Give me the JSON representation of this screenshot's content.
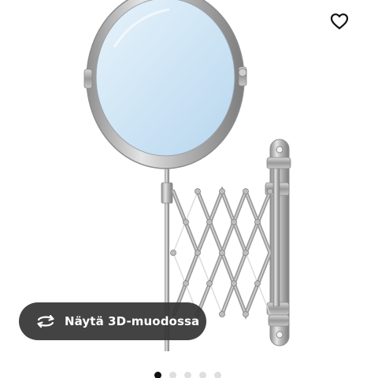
{
  "product": {
    "image_subject": "extendable-wall-mirror"
  },
  "favorite": {
    "icon": "heart-outline-icon",
    "color": "#111111"
  },
  "view_3d": {
    "label": "Näytä 3D-muodossa",
    "icon": "rotate-3d-icon",
    "background": "#333333",
    "text_color": "#ffffff"
  },
  "carousel": {
    "total": 5,
    "active_index": 0,
    "active_color": "#111111",
    "inactive_color": "#dfdfdf"
  }
}
